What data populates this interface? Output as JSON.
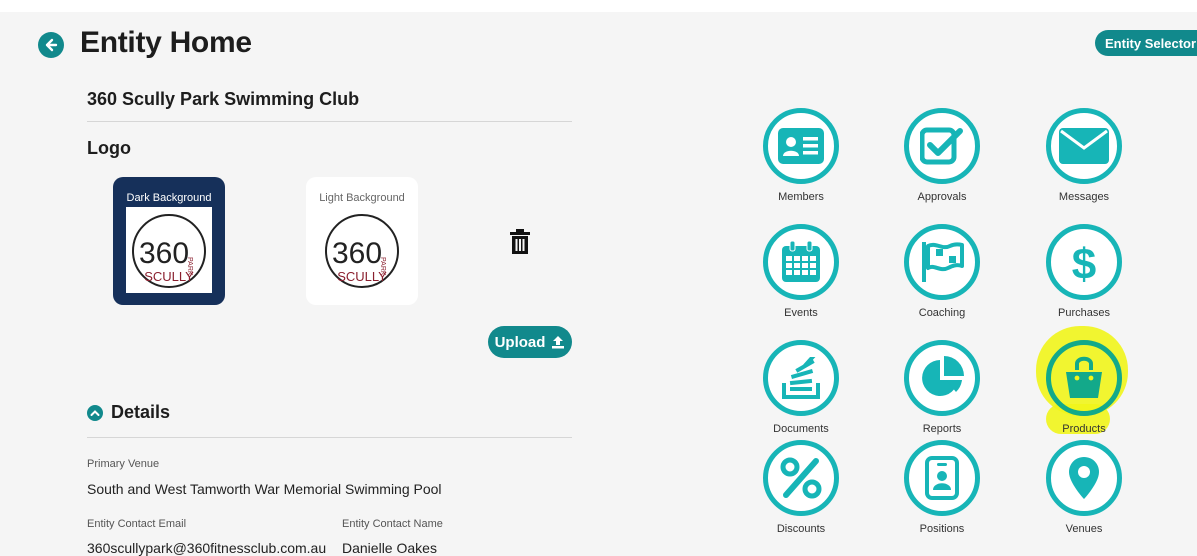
{
  "header": {
    "title": "Entity Home",
    "entity_selector_label": "Entity Selector"
  },
  "entity": {
    "name": "360 Scully Park Swimming Club"
  },
  "logo": {
    "heading": "Logo",
    "dark_caption": "Dark Background",
    "light_caption": "Light Background",
    "logo_text_number": "360",
    "logo_text_park": "PARK",
    "logo_text_scully": "SCULLY",
    "upload_label": "Upload"
  },
  "details": {
    "heading": "Details",
    "primary_venue_label": "Primary Venue",
    "primary_venue_value": "South and West Tamworth War Memorial Swimming Pool",
    "contact_email_label": "Entity Contact Email",
    "contact_email_value": "360scullypark@360fitnessclub.com.au",
    "contact_name_label": "Entity Contact Name",
    "contact_name_value": "Danielle Oakes"
  },
  "tiles": [
    {
      "label": "Members",
      "icon": "id-card-icon"
    },
    {
      "label": "Approvals",
      "icon": "check-square-icon"
    },
    {
      "label": "Messages",
      "icon": "envelope-icon"
    },
    {
      "label": "Events",
      "icon": "calendar-icon"
    },
    {
      "label": "Coaching",
      "icon": "flag-icon"
    },
    {
      "label": "Purchases",
      "icon": "dollar-icon"
    },
    {
      "label": "Documents",
      "icon": "document-stack-icon"
    },
    {
      "label": "Reports",
      "icon": "pie-chart-icon"
    },
    {
      "label": "Products",
      "icon": "shopping-bag-icon"
    },
    {
      "label": "Discounts",
      "icon": "percent-icon"
    },
    {
      "label": "Positions",
      "icon": "id-badge-icon"
    },
    {
      "label": "Venues",
      "icon": "map-pin-icon"
    }
  ],
  "colors": {
    "accent": "#11898c",
    "tile_icon": "#17b5b7",
    "highlight": "#f1f51b",
    "logo_dark_bg": "#16305a"
  }
}
